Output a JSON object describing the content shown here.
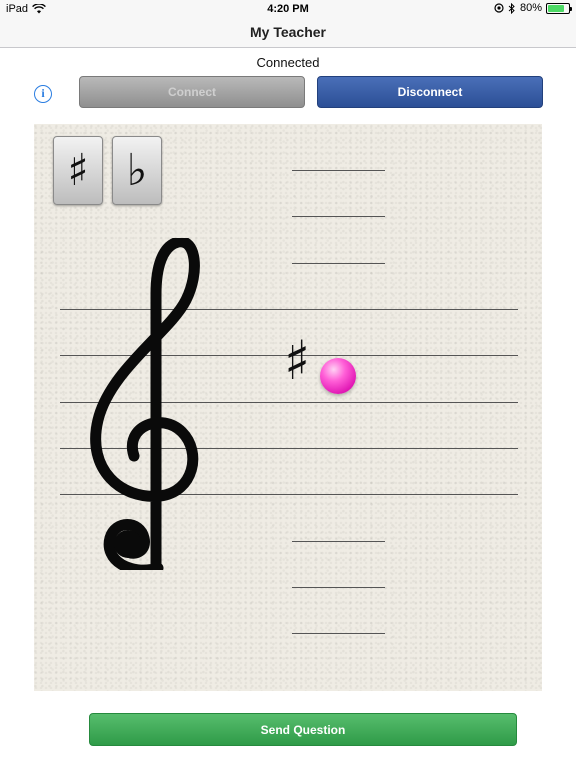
{
  "status_bar": {
    "device": "iPad",
    "time": "4:20 PM",
    "battery_percent": "80%",
    "battery_level": 0.8,
    "icons": [
      "wifi-icon",
      "location-icon",
      "bluetooth-icon",
      "battery-icon"
    ]
  },
  "nav": {
    "title": "My Teacher"
  },
  "connection": {
    "status": "Connected"
  },
  "controls": {
    "info_icon": "i",
    "connect_label": "Connect",
    "disconnect_label": "Disconnect"
  },
  "staff": {
    "clef": "treble-clef",
    "accidental_buttons": {
      "sharp": "♯",
      "flat": "♭"
    },
    "note": {
      "accidental": "♯",
      "color": "#ff3fc8"
    }
  },
  "footer": {
    "send_label": "Send Question"
  },
  "colors": {
    "connect_disabled": "#9e9e9e",
    "disconnect_blue": "#2f5199",
    "send_green": "#3aa853",
    "info_blue": "#2a7de1"
  }
}
